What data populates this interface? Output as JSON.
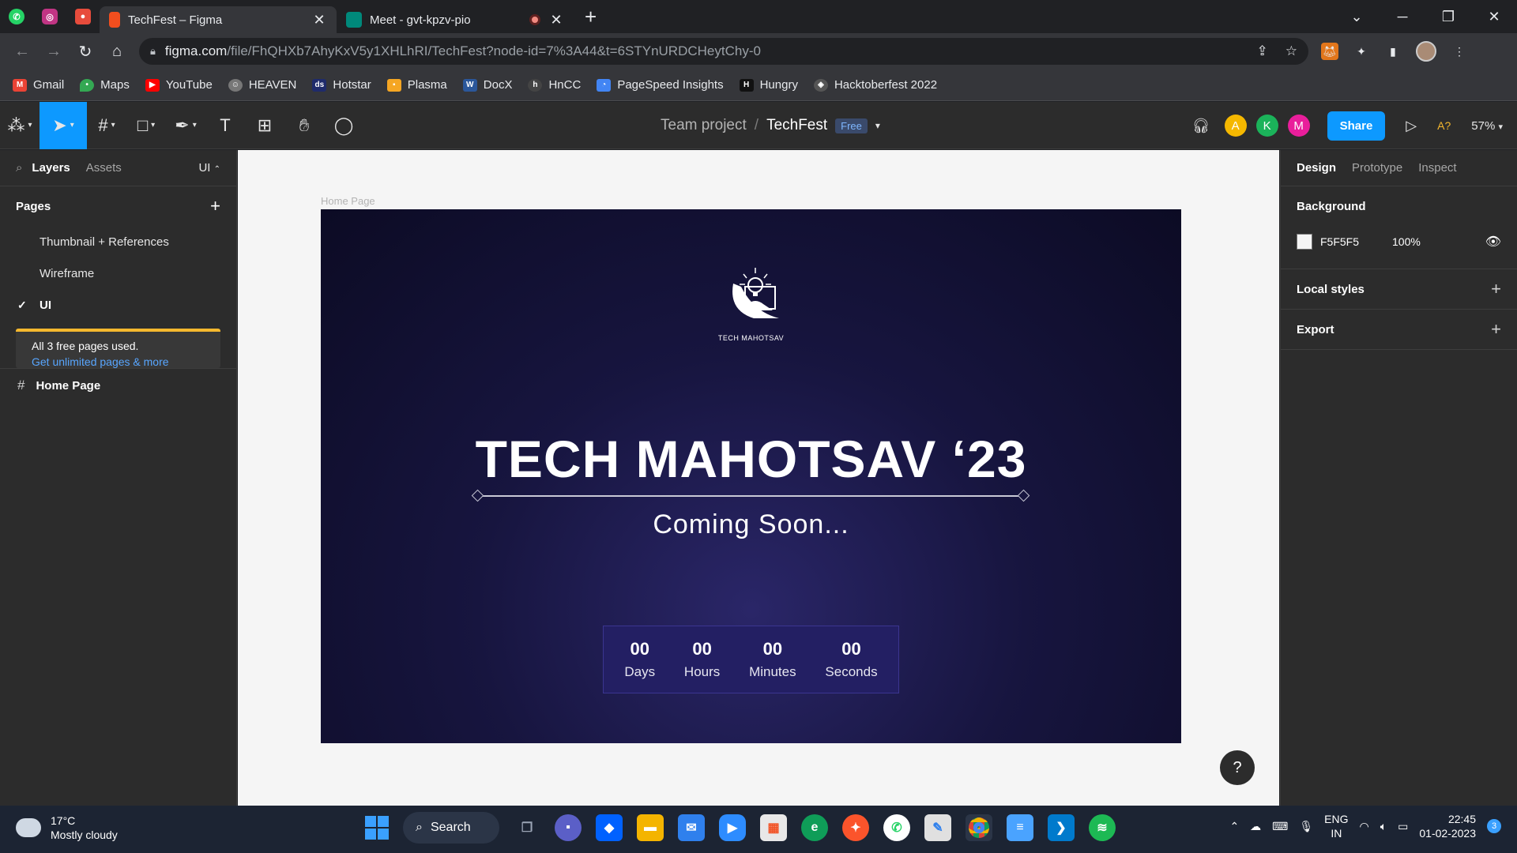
{
  "browser": {
    "pinned_tabs": [
      {
        "icon": "whatsapp-icon",
        "color": "#25d366"
      },
      {
        "icon": "instagram-icon",
        "color": "#c13584"
      },
      {
        "icon": "shield-extension-icon",
        "color": "#e74c3c"
      }
    ],
    "tabs": [
      {
        "title": "TechFest – Figma",
        "icon": "figma-icon",
        "active": true
      },
      {
        "title": "Meet - gvt-kpzv-pio",
        "icon": "google-meet-icon",
        "active": false
      }
    ],
    "url_host": "figma.com",
    "url_path": "/file/FhQHXb7AhyKxV5y1XHLhRI/TechFest?node-id=7%3A44&t=6STYnURDCHeytChy-0",
    "bookmarks": [
      {
        "label": "Gmail",
        "icon": "gmail-icon",
        "color": "#ea4335"
      },
      {
        "label": "Maps",
        "icon": "maps-icon",
        "color": "#34a853"
      },
      {
        "label": "YouTube",
        "icon": "youtube-icon",
        "color": "#ff0000"
      },
      {
        "label": "HEAVEN",
        "icon": "heaven-icon",
        "color": "#777777"
      },
      {
        "label": "Hotstar",
        "icon": "hotstar-icon",
        "color": "#1f2b6b"
      },
      {
        "label": "Plasma",
        "icon": "plasma-icon",
        "color": "#f5a623"
      },
      {
        "label": "DocX",
        "icon": "word-icon",
        "color": "#2b579a"
      },
      {
        "label": "HnCC",
        "icon": "hncc-icon",
        "color": "#444444"
      },
      {
        "label": "PageSpeed Insights",
        "icon": "pagespeed-icon",
        "color": "#4285f4"
      },
      {
        "label": "Hungry",
        "icon": "hungry-icon",
        "color": "#111111"
      },
      {
        "label": "Hacktoberfest 2022",
        "icon": "hacktoberfest-icon",
        "color": "#555555"
      }
    ]
  },
  "figma": {
    "breadcrumb_project": "Team project",
    "breadcrumb_sep": "/",
    "file_name": "TechFest",
    "plan_badge": "Free",
    "avatars": [
      {
        "letter": "A",
        "color": "#f5b800"
      },
      {
        "letter": "K",
        "color": "#1bb35a"
      },
      {
        "letter": "M",
        "color": "#e91e9b"
      }
    ],
    "share_label": "Share",
    "font_warning": "A?",
    "zoom": "57%",
    "left": {
      "tab_layers": "Layers",
      "tab_assets": "Assets",
      "current_page_short": "UI",
      "pages_title": "Pages",
      "pages": [
        {
          "name": "Thumbnail + References",
          "current": false
        },
        {
          "name": "Wireframe",
          "current": false
        },
        {
          "name": "UI",
          "current": true
        }
      ],
      "limit_text": "All 3 free pages used.",
      "limit_link": "Get unlimited pages & more",
      "layers": [
        {
          "name": "Home Page"
        }
      ]
    },
    "canvas": {
      "frame_label": "Home Page",
      "logo_caption": "TECH MAHOTSAV",
      "hero_title": "TECH MAHOTSAV ‘23",
      "subtitle": "Coming Soon...",
      "countdown": [
        {
          "value": "00",
          "label": "Days"
        },
        {
          "value": "00",
          "label": "Hours"
        },
        {
          "value": "00",
          "label": "Minutes"
        },
        {
          "value": "00",
          "label": "Seconds"
        }
      ]
    },
    "right": {
      "tab_design": "Design",
      "tab_prototype": "Prototype",
      "tab_inspect": "Inspect",
      "background_title": "Background",
      "background_hex": "F5F5F5",
      "background_opacity": "100%",
      "local_styles": "Local styles",
      "export": "Export"
    },
    "help": "?"
  },
  "taskbar": {
    "temperature": "17°C",
    "weather": "Mostly cloudy",
    "search_label": "Search",
    "apps": [
      {
        "icon": "task-view-icon",
        "color": "#6b7280"
      },
      {
        "icon": "teams-chat-icon",
        "color": "#5b5fc7"
      },
      {
        "icon": "dropbox-icon",
        "color": "#0061ff"
      },
      {
        "icon": "file-explorer-icon",
        "color": "#f4b400"
      },
      {
        "icon": "mail-icon",
        "color": "#2f80ed"
      },
      {
        "icon": "zoom-icon",
        "color": "#2d8cff"
      },
      {
        "icon": "ms-store-icon",
        "color": "#f25022"
      },
      {
        "icon": "edge-icon",
        "color": "#0f9d58"
      },
      {
        "icon": "brave-icon",
        "color": "#fb542b"
      },
      {
        "icon": "whatsapp-desktop-icon",
        "color": "#25d366"
      },
      {
        "icon": "pdf-editor-icon",
        "color": "#e0e0e0"
      },
      {
        "icon": "chrome-icon",
        "color": "#db4437",
        "running": true
      },
      {
        "icon": "notepad-icon",
        "color": "#4aa3ff"
      },
      {
        "icon": "vscode-icon",
        "color": "#007acc"
      },
      {
        "icon": "spotify-icon",
        "color": "#1db954"
      }
    ],
    "lang_top": "ENG",
    "lang_bottom": "IN",
    "time": "22:45",
    "date": "01-02-2023",
    "notification_count": "3"
  }
}
